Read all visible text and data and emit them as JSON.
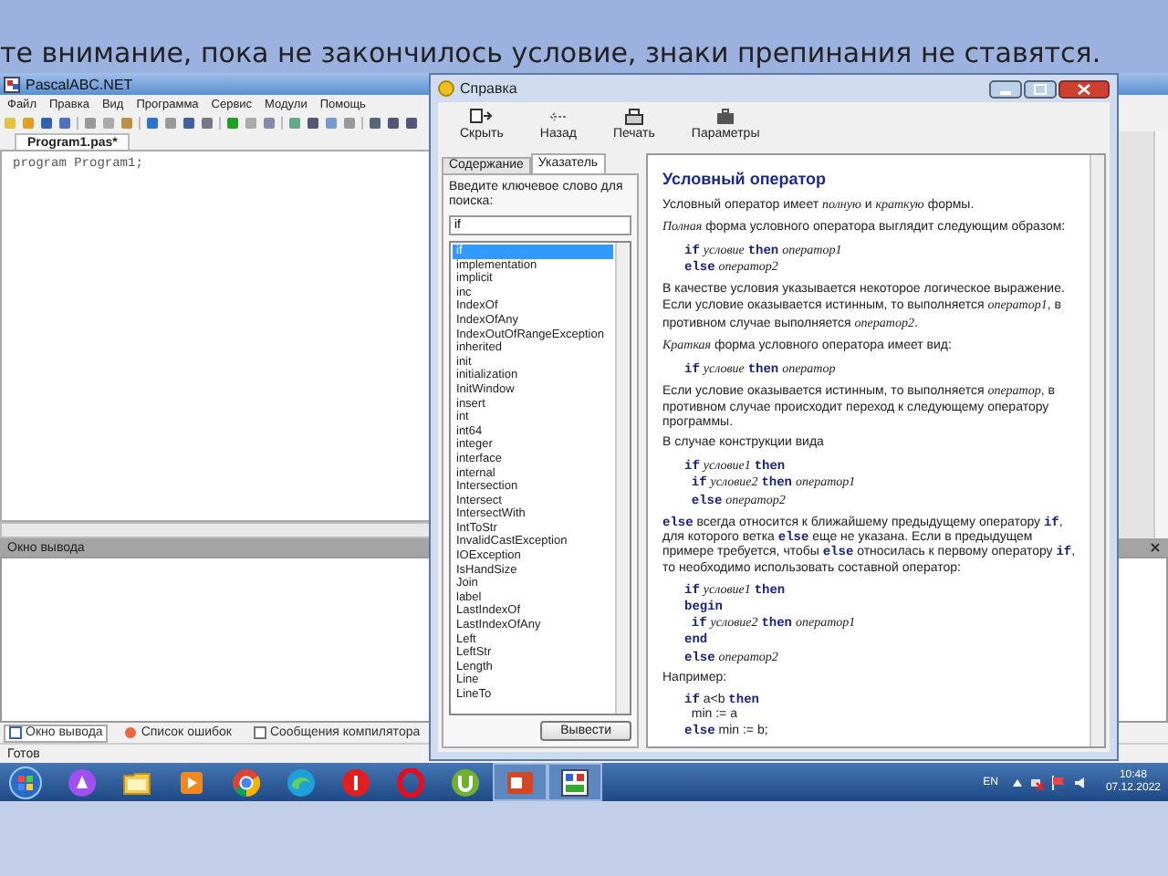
{
  "caption": "те внимание, пока не закончилось условие, знаки препинания не ставятся.",
  "ide": {
    "title": "PascalABC.NET",
    "menu": [
      "Файл",
      "Правка",
      "Вид",
      "Программа",
      "Сервис",
      "Модули",
      "Помощь"
    ],
    "file_tabs": [
      {
        "label": "Program1.pas*",
        "selected": true
      }
    ],
    "code": [
      "program Program1;"
    ],
    "output_title": "Окно вывода",
    "bottom_tabs": [
      {
        "label": "Окно вывода",
        "selected": true
      },
      {
        "label": "Список ошибок",
        "selected": false
      },
      {
        "label": "Сообщения компилятора",
        "selected": false
      }
    ],
    "status": "Готов"
  },
  "help": {
    "title": "Справка",
    "toolbar": [
      {
        "kind": "hide",
        "label": "Скрыть"
      },
      {
        "kind": "back",
        "label": "Назад"
      },
      {
        "kind": "print",
        "label": "Печать"
      },
      {
        "kind": "options",
        "label": "Параметры"
      }
    ],
    "tabs": [
      {
        "label": "Содержание",
        "selected": false
      },
      {
        "label": "Указатель",
        "selected": true
      }
    ],
    "search": {
      "label": "Введите ключевое слово для поиска:",
      "value": "if"
    },
    "index": [
      {
        "label": "if",
        "selected": true
      },
      {
        "label": "implementation",
        "selected": false
      },
      {
        "label": "implicit",
        "selected": false
      },
      {
        "label": "inc",
        "selected": false
      },
      {
        "label": "IndexOf",
        "selected": false
      },
      {
        "label": "IndexOfAny",
        "selected": false
      },
      {
        "label": "IndexOutOfRangeException",
        "selected": false
      },
      {
        "label": "inherited",
        "selected": false
      },
      {
        "label": "init",
        "selected": false
      },
      {
        "label": "initialization",
        "selected": false
      },
      {
        "label": "InitWindow",
        "selected": false
      },
      {
        "label": "insert",
        "selected": false
      },
      {
        "label": "int",
        "selected": false
      },
      {
        "label": "int64",
        "selected": false
      },
      {
        "label": "integer",
        "selected": false
      },
      {
        "label": "interface",
        "selected": false
      },
      {
        "label": "internal",
        "selected": false
      },
      {
        "label": "Intersection",
        "selected": false
      },
      {
        "label": "Intersect",
        "selected": false
      },
      {
        "label": "IntersectWith",
        "selected": false
      },
      {
        "label": "IntToStr",
        "selected": false
      },
      {
        "label": "InvalidCastException",
        "selected": false
      },
      {
        "label": "IOException",
        "selected": false
      },
      {
        "label": "IsHandSize",
        "selected": false
      },
      {
        "label": "Join",
        "selected": false
      },
      {
        "label": "label",
        "selected": false
      },
      {
        "label": "LastIndexOf",
        "selected": false
      },
      {
        "label": "LastIndexOfAny",
        "selected": false
      },
      {
        "label": "Left",
        "selected": false
      },
      {
        "label": "LeftStr",
        "selected": false
      },
      {
        "label": "Length",
        "selected": false
      },
      {
        "label": "Line",
        "selected": false
      },
      {
        "label": "LineTo",
        "selected": false
      }
    ],
    "button": "Вывести",
    "article": {
      "title": "Условный оператор",
      "blocks": [
        {
          "kind": "p",
          "text": "Условный оператор имеет *полную* и *краткую* формы."
        },
        {
          "kind": "p",
          "text": "*Полная* форма условного оператора выглядит следующим образом:"
        },
        {
          "kind": "code",
          "lines": [
            "**if** *условие* **then** *оператор1*",
            "**else** *оператор2*"
          ]
        },
        {
          "kind": "p",
          "text": "В качестве условия указывается некоторое логическое выражение. Если условие оказывается истинным, то выполняется *оператор1*, в противном случае выполняется *оператор2*."
        },
        {
          "kind": "p",
          "text": "*Краткая* форма условного оператора имеет вид:"
        },
        {
          "kind": "code",
          "lines": [
            "**if** *условие* **then** *оператор*"
          ]
        },
        {
          "kind": "p",
          "text": "Если условие оказывается истинным, то выполняется *оператор*, в противном случае происходит переход к следующему оператору программы."
        },
        {
          "kind": "p",
          "text": "В случае конструкции вида"
        },
        {
          "kind": "code",
          "lines": [
            "**if** *условие1* **then**",
            "  **if** *условие2* **then** *оператор1*",
            "  **else** *оператор2*"
          ]
        },
        {
          "kind": "p",
          "text": "**else** всегда относится к ближайшему предыдущему оператору **if**, для которого ветка **else** еще не указана. Если в предыдущем примере требуется, чтобы **else** относилась к первому оператору **if**, то необходимо использовать составной оператор:"
        },
        {
          "kind": "code",
          "lines": [
            "**if** *условие1* **then**",
            "**begin**",
            "  **if** *условие2* **then** *оператор1*",
            "**end**",
            "**else** *оператор2*"
          ]
        },
        {
          "kind": "p",
          "text": "Например:"
        },
        {
          "kind": "code",
          "lines": [
            "**if** a<b **then**",
            "  min := a",
            "**else** min := b;"
          ]
        }
      ]
    }
  },
  "taskbar": {
    "apps": [
      {
        "kind": "assistant",
        "selected": false
      },
      {
        "kind": "folder",
        "selected": false
      },
      {
        "kind": "player",
        "selected": false
      },
      {
        "kind": "browser",
        "selected": false
      },
      {
        "kind": "wave",
        "selected": false
      },
      {
        "kind": "redcircle",
        "selected": false
      },
      {
        "kind": "ring",
        "selected": false
      },
      {
        "kind": "torrent",
        "selected": false
      },
      {
        "kind": "slides",
        "selected": true
      },
      {
        "kind": "abc",
        "selected": true
      }
    ],
    "language": "EN",
    "time": "10:48",
    "date": "07.12.2022"
  }
}
